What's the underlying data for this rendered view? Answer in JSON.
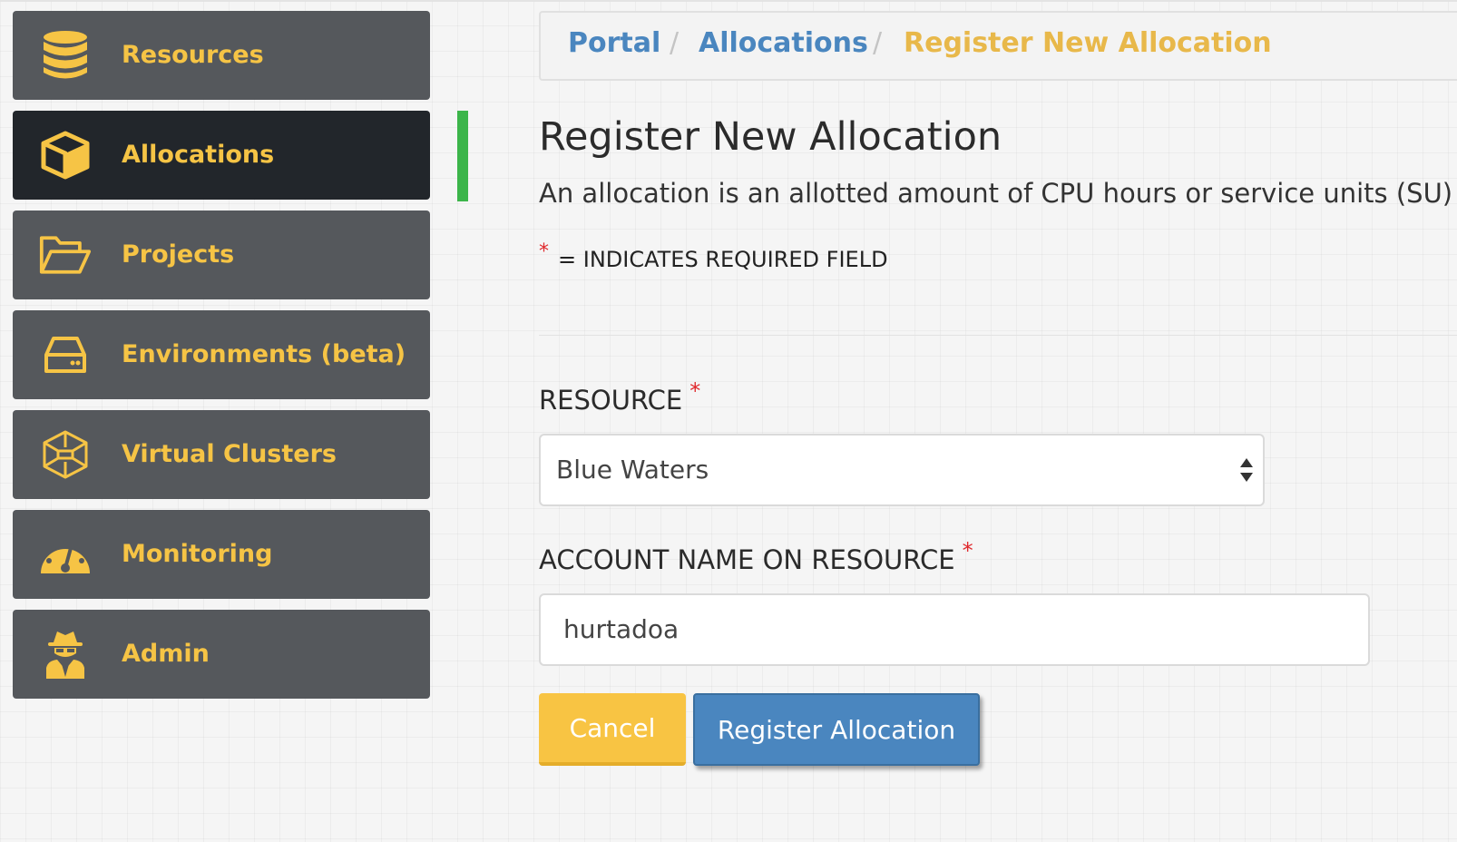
{
  "sidebar": {
    "items": [
      {
        "label": "Resources",
        "icon": "database-icon",
        "active": false
      },
      {
        "label": "Allocations",
        "icon": "cube-icon",
        "active": true
      },
      {
        "label": "Projects",
        "icon": "folder-open-icon",
        "active": false
      },
      {
        "label": "Environments (beta)",
        "icon": "hard-drive-icon",
        "active": false
      },
      {
        "label": "Virtual Clusters",
        "icon": "cluster-icon",
        "active": false
      },
      {
        "label": "Monitoring",
        "icon": "gauge-icon",
        "active": false
      },
      {
        "label": "Admin",
        "icon": "user-secret-icon",
        "active": false
      }
    ]
  },
  "breadcrumb": {
    "items": [
      "Portal",
      "Allocations",
      "Register New Allocation"
    ],
    "separator": "/"
  },
  "main": {
    "title": "Register New Allocation",
    "description": "An allocation is an allotted amount of CPU hours or service units (SU)",
    "required_marker": "*",
    "required_note": "= INDICATES REQUIRED FIELD",
    "form": {
      "resource_label": "RESOURCE",
      "resource_value": "Blue Waters",
      "account_label": "ACCOUNT NAME ON RESOURCE",
      "account_value": "hurtadoa"
    },
    "buttons": {
      "cancel": "Cancel",
      "register": "Register Allocation"
    }
  },
  "colors": {
    "accent_yellow": "#f6c445",
    "link_blue": "#4a86bf",
    "active_indicator": "#3cb54a",
    "required_red": "#e0282c"
  }
}
